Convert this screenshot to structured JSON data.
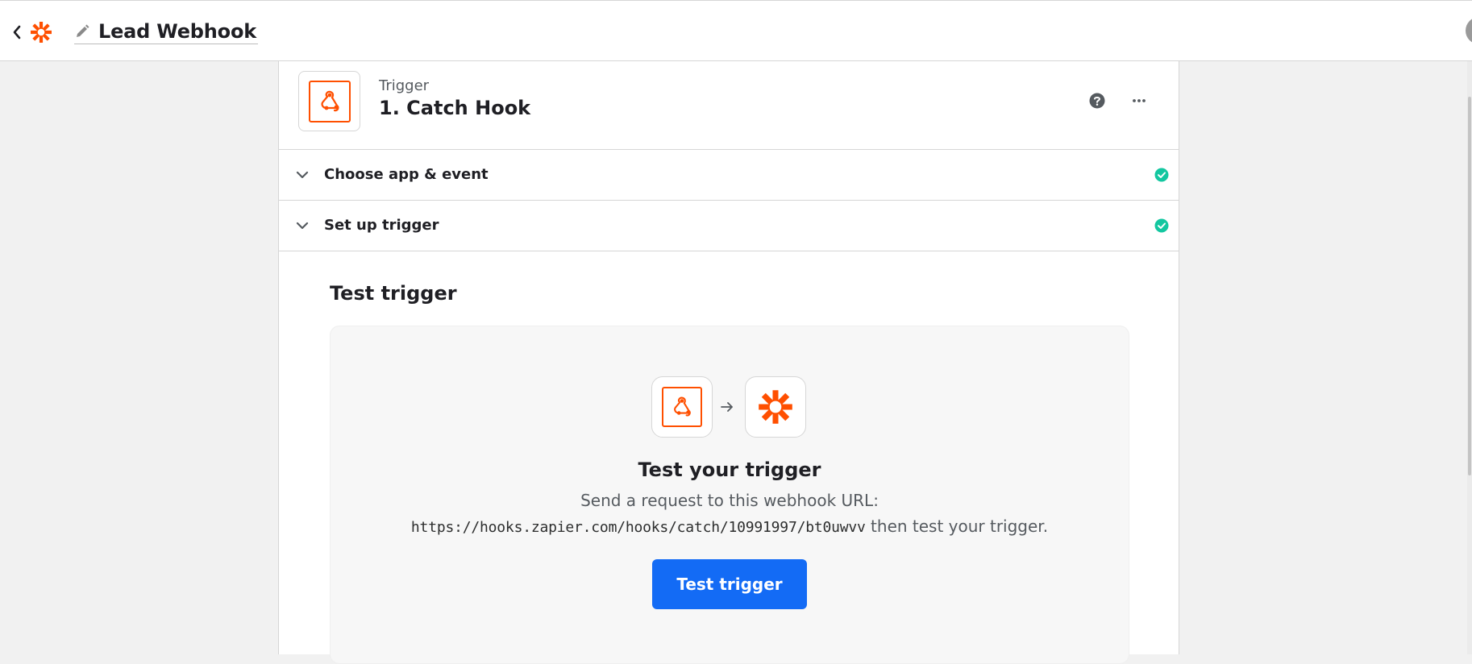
{
  "header": {
    "zap_title": "Lead Webhook",
    "icons": {
      "back": "chevron-left-icon",
      "brand": "zapier-asterisk-icon",
      "edit": "pencil-icon"
    }
  },
  "step": {
    "kind_label": "Trigger",
    "name": "1. Catch Hook",
    "app_icon": "webhook-icon",
    "actions": {
      "help": "help-circle-icon",
      "more": "more-horizontal-icon"
    }
  },
  "sections": [
    {
      "label": "Choose app & event",
      "status": "complete"
    },
    {
      "label": "Set up trigger",
      "status": "complete"
    }
  ],
  "test": {
    "heading": "Test trigger",
    "card": {
      "title": "Test your trigger",
      "instruction": "Send a request to this webhook URL:",
      "webhook_url": "https://hooks.zapier.com/hooks/catch/10991997/bt0uwvv",
      "instruction_suffix": " then test your trigger.",
      "button_label": "Test trigger"
    }
  },
  "colors": {
    "brand_orange": "#ff4f00",
    "primary_blue": "#136bf5",
    "success_teal": "#13c7a0",
    "border": "#d6d6d6",
    "page_background": "#f1f1f1"
  }
}
